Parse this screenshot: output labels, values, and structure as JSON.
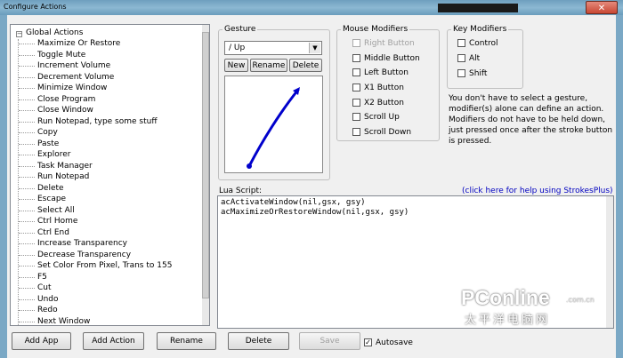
{
  "window": {
    "title": "Configure Actions",
    "close_label": "✕"
  },
  "tree": {
    "root_label": "Global Actions",
    "expander": "−",
    "items": [
      "Maximize Or Restore",
      "Toggle Mute",
      "Increment Volume",
      "Decrement Volume",
      "Minimize Window",
      "Close Program",
      "Close Window",
      "Run Notepad, type some stuff",
      "Copy",
      "Paste",
      "Explorer",
      "Task Manager",
      "Run Notepad",
      "Delete",
      "Escape",
      "Select All",
      "Ctrl Home",
      "Ctrl End",
      "Increase Transparency",
      "Decrease Transparency",
      "Set Color From Pixel, Trans to 155",
      "F5",
      "Cut",
      "Undo",
      "Redo",
      "Next Window"
    ]
  },
  "gesture": {
    "legend": "Gesture",
    "selected": "/ Up",
    "new_label": "New",
    "rename_label": "Rename",
    "delete_label": "Delete"
  },
  "mouse_modifiers": {
    "legend": "Mouse Modifiers",
    "items": [
      {
        "label": "Right Button",
        "enabled": false
      },
      {
        "label": "Middle Button",
        "enabled": true
      },
      {
        "label": "Left Button",
        "enabled": true
      },
      {
        "label": "X1 Button",
        "enabled": true
      },
      {
        "label": "X2 Button",
        "enabled": true
      },
      {
        "label": "Scroll Up",
        "enabled": true
      },
      {
        "label": "Scroll Down",
        "enabled": true
      }
    ]
  },
  "key_modifiers": {
    "legend": "Key Modifiers",
    "items": [
      "Control",
      "Alt",
      "Shift"
    ]
  },
  "info_text": "You don't have to select a gesture, modifier(s) alone can define an action. Modifiers do not have to be held down, just pressed once after the stroke button is pressed.",
  "lua": {
    "label": "Lua Script:",
    "help_link": "(click here for help using StrokesPlus)",
    "lines": [
      "acActivateWindow(nil,gsx, gsy)",
      "acMaximizeOrRestoreWindow(nil,gsx, gsy)"
    ]
  },
  "bottom": {
    "add_app": "Add App",
    "add_action": "Add Action",
    "rename": "Rename",
    "delete": "Delete",
    "save": "Save",
    "autosave": "Autosave",
    "autosave_checked": true
  },
  "watermark": {
    "brand": "PConline",
    "domain": ".com.cn",
    "chinese": "太平洋电脑网"
  },
  "colors": {
    "stroke": "#0000cc",
    "link": "#0000c0",
    "titlebar": "#7aa8c5"
  }
}
